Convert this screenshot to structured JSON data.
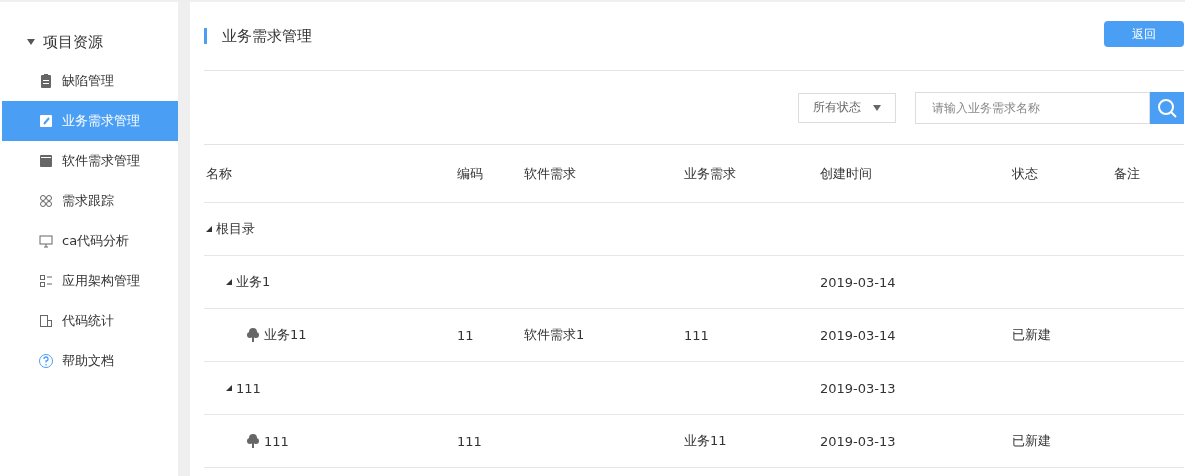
{
  "sidebar": {
    "group": {
      "label": "项目资源",
      "expanded": true
    },
    "items": [
      {
        "label": "缺陷管理",
        "selected": false
      },
      {
        "label": "业务需求管理",
        "selected": true
      },
      {
        "label": "软件需求管理",
        "selected": false
      },
      {
        "label": "需求跟踪",
        "selected": false
      },
      {
        "label": "ca代码分析",
        "selected": false
      },
      {
        "label": "应用架构管理",
        "selected": false
      },
      {
        "label": "代码统计",
        "selected": false
      },
      {
        "label": "帮助文档",
        "selected": false
      }
    ]
  },
  "header": {
    "title": "业务需求管理",
    "back_button": "返回"
  },
  "filters": {
    "status_select": "所有状态",
    "search": {
      "placeholder": "请输入业务需求名称"
    }
  },
  "table": {
    "columns": [
      "名称",
      "编码",
      "软件需求",
      "业务需求",
      "创建时间",
      "状态",
      "备注"
    ],
    "rows": [
      {
        "cells": [
          "根目录",
          "",
          "",
          "",
          "",
          "",
          ""
        ],
        "expanded": true,
        "children": [
          {
            "cells": [
              "业务1",
              "",
              "",
              "",
              "2019-03-14",
              "",
              ""
            ],
            "expanded": true,
            "children": [
              {
                "cells": [
                  "业务11",
                  "11",
                  "软件需求1",
                  "111",
                  "2019-03-14",
                  "已新建",
                  ""
                ]
              }
            ]
          },
          {
            "cells": [
              "111",
              "",
              "",
              "",
              "2019-03-13",
              "",
              ""
            ],
            "expanded": true,
            "children": [
              {
                "cells": [
                  "111",
                  "111",
                  "",
                  "业务11",
                  "2019-03-13",
                  "已新建",
                  ""
                ]
              }
            ]
          }
        ]
      }
    ]
  }
}
